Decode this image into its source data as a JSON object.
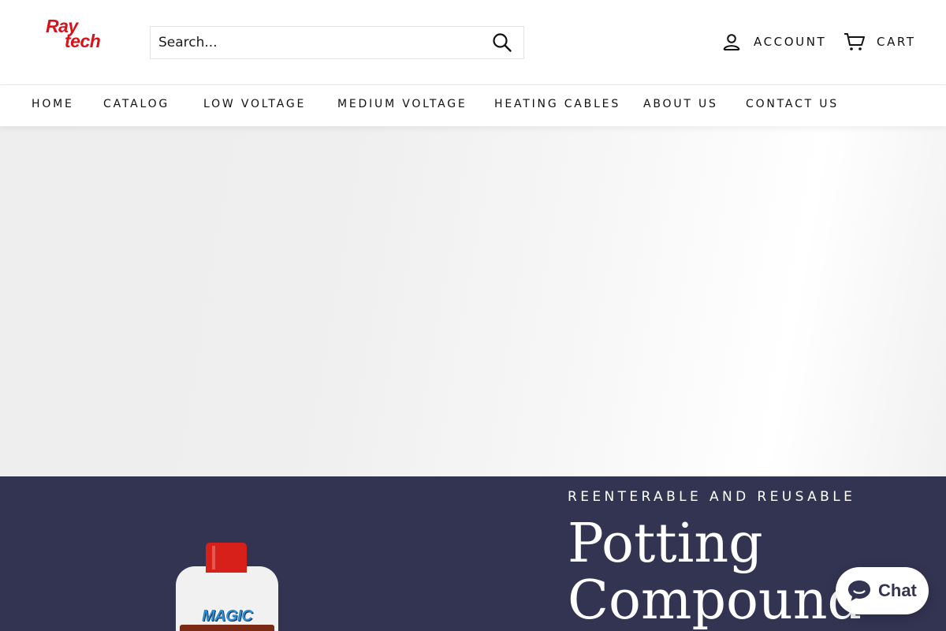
{
  "brand": {
    "logo_line1": "Ray",
    "logo_line2": "tech",
    "logo_color": "#d6121b"
  },
  "search": {
    "placeholder": "Search...",
    "button_icon": "search-icon"
  },
  "header": {
    "account_label": "ACCOUNT",
    "account_icon": "user-icon",
    "cart_label": "CART",
    "cart_icon": "cart-icon"
  },
  "nav": {
    "items": [
      {
        "label": "HOME"
      },
      {
        "label": "CATALOG"
      },
      {
        "label": "LOW VOLTAGE"
      },
      {
        "label": "MEDIUM VOLTAGE"
      },
      {
        "label": "HEATING CABLES"
      },
      {
        "label": "ABOUT US"
      },
      {
        "label": "CONTACT US"
      }
    ]
  },
  "promo": {
    "eyebrow": "REENTERABLE AND REUSABLE",
    "title_line1": "Potting",
    "title_line2": "Compound",
    "product_label": "MAGIC",
    "background": "#333452"
  },
  "chat": {
    "label": "Chat",
    "icon": "chat-bubble-icon"
  }
}
